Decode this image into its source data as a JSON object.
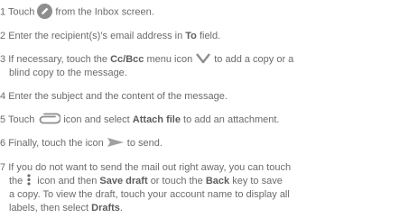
{
  "steps": [
    {
      "num": "1",
      "a": "Touch",
      "b": "from the Inbox screen."
    },
    {
      "num": "2",
      "a": "Enter the recipient(s)’s email address in",
      "bold1": "To",
      "b": "field."
    },
    {
      "num": "3",
      "a": "If necessary, touch the",
      "bold1": "Cc/Bcc",
      "b": "menu icon",
      "c": "to add a copy or a",
      "line2": "blind copy to the message."
    },
    {
      "num": "4",
      "a": "Enter the subject and the content of the message."
    },
    {
      "num": "5",
      "a": "Touch",
      "b": "icon and select",
      "bold1": "Attach file",
      "c": "to add an attachment."
    },
    {
      "num": "6",
      "a": "Finally, touch the icon",
      "b": "to send."
    },
    {
      "num": "7",
      "line1": "If you do not want to send the mail out right away, you can touch",
      "line2a": "the",
      "line2b": "icon and then",
      "bold1": "Save draft",
      "line2c": "or touch the",
      "bold2": "Back",
      "line2d": "key to save",
      "line3": "a copy. To view the draft, touch your account name to display all",
      "line4a": "labels, then select",
      "bold3": "Drafts",
      "line4b": "."
    }
  ],
  "icons": {
    "compose": "pencil-icon",
    "ccbcc": "chevron-down-icon",
    "attach": "paperclip-icon",
    "send": "send-icon",
    "more": "more-vertical-icon"
  },
  "colors": {
    "text": "#6b6b6b",
    "icon": "#8e8e8e",
    "send": "#a0a0a0"
  }
}
